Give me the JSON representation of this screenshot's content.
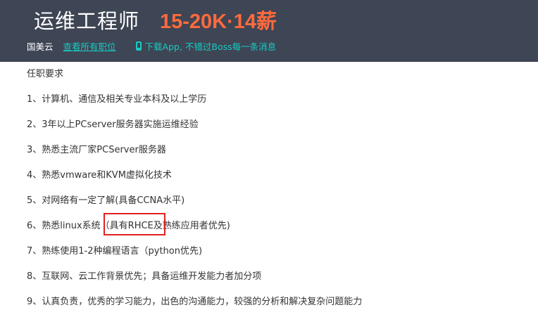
{
  "header": {
    "job_title": "运维工程师",
    "salary": "15-20K·14薪",
    "company": "国美云",
    "all_jobs_link": "查看所有职位",
    "app_promo": "下载App, 不错过Boss每一条消息",
    "app_promo_icon": "phone-icon"
  },
  "description": {
    "heading": "任职要求",
    "items": [
      "1、计算机、通信及相关专业本科及以上学历",
      "2、3年以上PCserver服务器实施运维经验",
      "3、熟悉主流厂家PCServer服务器",
      "4、熟悉vmware和KVM虚拟化技术",
      "5、对网络有一定了解(具备CCNA水平)",
      "6、熟悉linux系统（具有RHCE及熟练应用者优先)",
      "7、熟练使用1-2种编程语言（python优先)",
      "8、互联网、云工作背景优先；具备运维开发能力者加分项",
      "9、认真负责，优秀的学习能力，出色的沟通能力，较强的分析和解决复杂问题能力"
    ]
  },
  "colors": {
    "header_bg": "#3e4554",
    "salary": "#ff6a3d",
    "link": "#1ac9c0",
    "text": "#333333",
    "highlight_box": "#e02020"
  }
}
